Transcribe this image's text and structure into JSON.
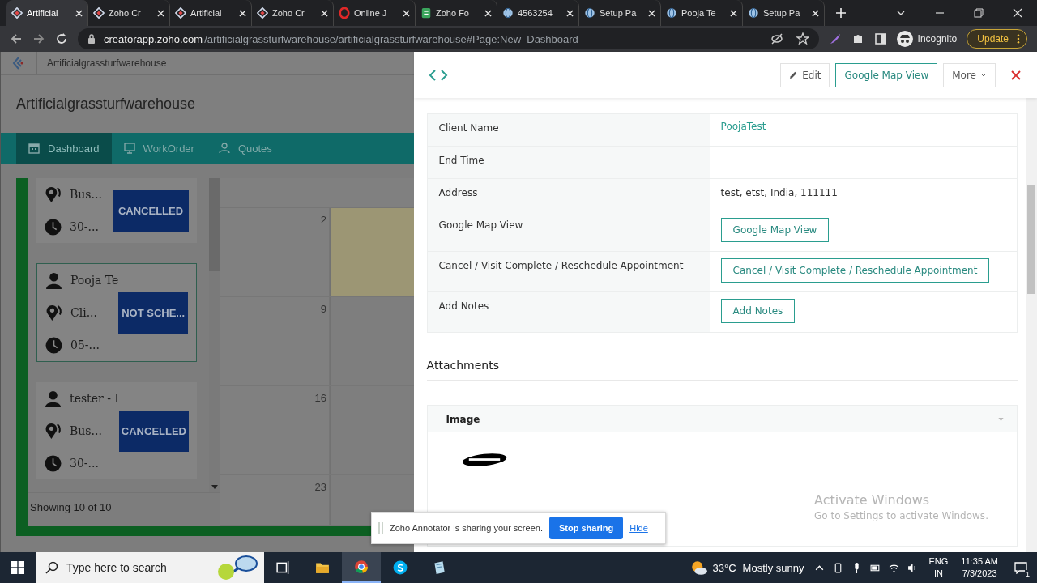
{
  "browser": {
    "tabs": [
      {
        "title": "Artificial",
        "kind": "zoho",
        "selected": true
      },
      {
        "title": "Zoho Cr",
        "kind": "zoho",
        "selected": false
      },
      {
        "title": "Artificial",
        "kind": "zoho",
        "selected": false
      },
      {
        "title": "Zoho Cr",
        "kind": "zoho",
        "selected": false
      },
      {
        "title": "Online J",
        "kind": "opera",
        "selected": false
      },
      {
        "title": "Zoho Fo",
        "kind": "form",
        "selected": false
      },
      {
        "title": "4563254",
        "kind": "globe",
        "selected": false
      },
      {
        "title": "Setup Pa",
        "kind": "globe",
        "selected": false
      },
      {
        "title": "Pooja Te",
        "kind": "globe",
        "selected": false
      },
      {
        "title": "Setup Pa",
        "kind": "globe",
        "selected": false
      }
    ],
    "url_host": "creatorapp.zoho.com",
    "url_path": "/artificialgrassturfwarehouse/artificialgrassturfwarehouse#Page:New_Dashboard",
    "profile": "Incognito",
    "update_button": "Update"
  },
  "app": {
    "breadcrumb": "Artificialgrassturfwarehouse",
    "title": "Artificialgrassturfwarehouse",
    "nav": [
      {
        "label": "Dashboard",
        "kind": "calendar",
        "selected": true
      },
      {
        "label": "WorkOrder",
        "kind": "monitor",
        "selected": false
      },
      {
        "label": "Quotes",
        "kind": "user",
        "selected": false
      }
    ],
    "cards": [
      {
        "place": "Bus...",
        "time": "30-...",
        "status": "CANCELLED",
        "selected": false
      },
      {
        "name": "Pooja Te",
        "place": "Cli...",
        "time": "05-...",
        "status": "NOT SCHE...",
        "selected": true
      },
      {
        "name": "tester - I",
        "place": "Bus...",
        "time": "30-...",
        "status": "CANCELLED",
        "selected": false
      }
    ],
    "footer": "Showing 10 of 10",
    "weeks": [
      {
        "day": "2",
        "highlighted": true
      },
      {
        "day": "9",
        "highlighted": false
      },
      {
        "day": "16",
        "highlighted": false
      },
      {
        "day": "23",
        "highlighted": false
      }
    ]
  },
  "panel": {
    "actions": [
      {
        "label": "Edit",
        "kind": "edit"
      },
      {
        "label": "Google Map View",
        "kind": "primary"
      },
      {
        "label": "More",
        "kind": "more"
      }
    ],
    "fields": [
      {
        "label": "Client Name",
        "kind": "link",
        "value": "PoojaTest"
      },
      {
        "label": "End Time",
        "kind": "empty"
      },
      {
        "label": "Address",
        "kind": "text",
        "value": "test, etst, India, 111111"
      },
      {
        "label": "Google Map View",
        "kind": "button",
        "value": "Google Map View"
      },
      {
        "label": "Cancel / Visit Complete / Reschedule Appointment",
        "kind": "button",
        "value": "Cancel / Visit Complete / Reschedule Appointment"
      },
      {
        "label": "Add Notes",
        "kind": "button",
        "value": "Add Notes"
      }
    ],
    "attachments_heading": "Attachments",
    "image_section": "Image"
  },
  "activation": {
    "title": "Activate Windows",
    "subtitle": "Go to Settings to activate Windows."
  },
  "sharing_bar": {
    "message": "Zoho Annotator is sharing your screen.",
    "stop_button": "Stop sharing",
    "hide_link": "Hide"
  },
  "taskbar": {
    "search_placeholder": "Type here to search",
    "apps": [
      {
        "kind": "taskview",
        "running": false
      },
      {
        "kind": "explorer",
        "running": false
      },
      {
        "kind": "chrome",
        "running": true
      },
      {
        "kind": "skype",
        "running": false
      },
      {
        "kind": "notepad",
        "running": false
      }
    ],
    "temperature": "33°C",
    "weather": "Mostly sunny",
    "language": "ENG",
    "region": "IN",
    "time": "11:35 AM",
    "date": "7/3/2023",
    "notifications": "1"
  }
}
